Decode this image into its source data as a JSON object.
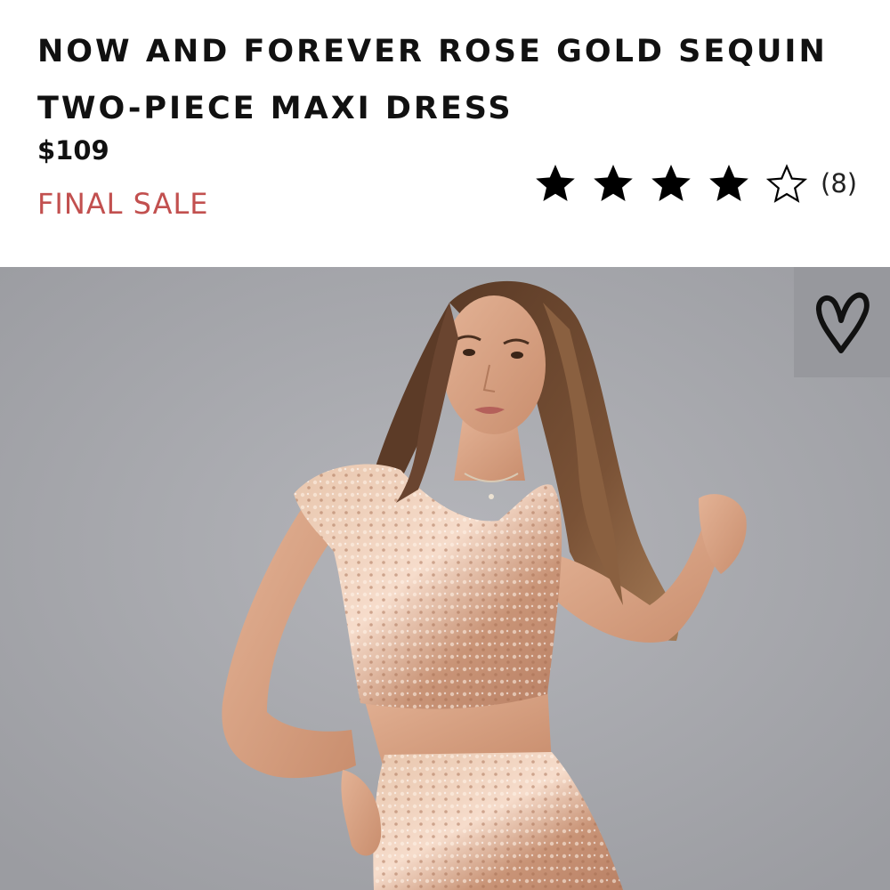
{
  "product": {
    "title": "NOW AND FOREVER ROSE GOLD SEQUIN TWO-PIECE MAXI DRESS",
    "price": "$109",
    "sale_label": "FINAL SALE",
    "sale_color": "#c2504f"
  },
  "rating": {
    "stars_filled": 4,
    "stars_total": 5,
    "review_count": "(8)"
  },
  "photo": {
    "background_color": "#a8a9ae"
  },
  "icons": {
    "wishlist": "heart-icon",
    "rating": "star-icon"
  }
}
